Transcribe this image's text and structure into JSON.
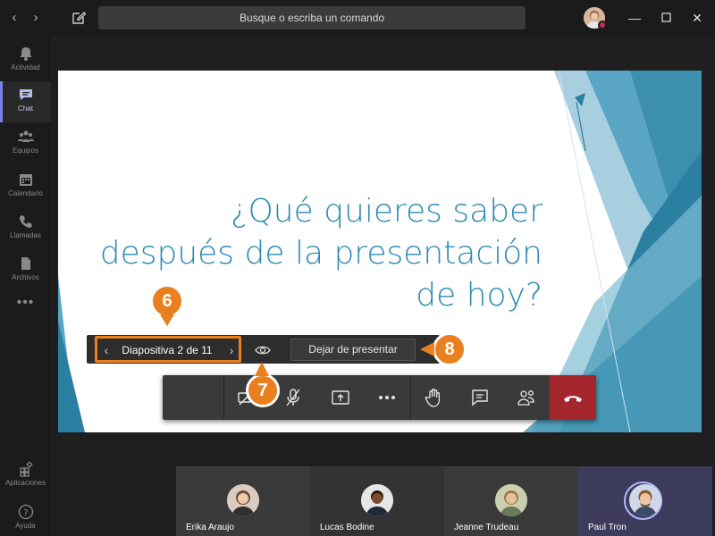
{
  "search": {
    "placeholder": "Busque o escriba un comando"
  },
  "sidebar": {
    "items": [
      {
        "label": "Actividad",
        "icon": "bell-icon"
      },
      {
        "label": "Chat",
        "icon": "chat-icon"
      },
      {
        "label": "Equipos",
        "icon": "teams-icon"
      },
      {
        "label": "Calendario",
        "icon": "calendar-icon"
      },
      {
        "label": "Llamadas",
        "icon": "phone-icon"
      },
      {
        "label": "Archivos",
        "icon": "file-icon"
      }
    ],
    "bottom": [
      {
        "label": "Aplicaciones",
        "icon": "apps-icon"
      },
      {
        "label": "Ayuda",
        "icon": "help-icon"
      }
    ]
  },
  "slide": {
    "title_line1": "¿Qué quieres saber",
    "title_line2": "después de la presentación",
    "title_line3": "de hoy?"
  },
  "presenter": {
    "counter": "Diapositiva 2 de 11",
    "stop_label": "Dejar de presentar"
  },
  "badges": {
    "b6": "6",
    "b7": "7",
    "b8": "8"
  },
  "participants": [
    {
      "name": "Erika Araujo"
    },
    {
      "name": "Lucas Bodine"
    },
    {
      "name": "Jeanne Trudeau"
    },
    {
      "name": "Paul Tron"
    }
  ],
  "colors": {
    "accent": "#e97f1e",
    "hangup": "#a4262c",
    "slide_blue": "#2d8ab5",
    "active_nav": "#7b83eb"
  }
}
